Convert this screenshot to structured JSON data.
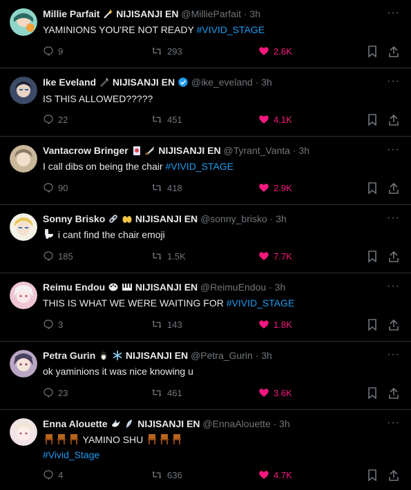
{
  "tweets": [
    {
      "name": "Millie Parfait",
      "name_emojis": [
        "wand"
      ],
      "agency": "NIJISANJI EN",
      "handle": "@MillieParfait",
      "time": "3h",
      "verified": false,
      "text": "YAMINIONS YOU'RE NOT READY",
      "hashtag": "#VIVID_STAGE",
      "text_emojis": [],
      "replies": "9",
      "retweets": "293",
      "likes": "2.6K",
      "avatar_color": "#8fd6c8"
    },
    {
      "name": "Ike Eveland",
      "name_emojis": [
        "pen"
      ],
      "agency": "NIJISANJI EN",
      "handle": "@ike_eveland",
      "time": "3h",
      "verified": true,
      "text": "IS THIS ALLOWED?????",
      "hashtag": "",
      "text_emojis": [],
      "replies": "22",
      "retweets": "451",
      "likes": "4.1K",
      "avatar_color": "#3b4a66"
    },
    {
      "name": "Vantacrow Bringer",
      "name_emojis": [
        "card",
        "knife"
      ],
      "agency": "NIJISANJI EN",
      "handle": "@Tyrant_Vanta",
      "time": "3h",
      "verified": false,
      "text": "I call dibs on being the chair",
      "hashtag": "#VIVID_STAGE",
      "text_emojis": [],
      "replies": "90",
      "retweets": "418",
      "likes": "2.9K",
      "avatar_color": "#c9b79a"
    },
    {
      "name": "Sonny Brisko",
      "name_emojis": [
        "link",
        "hands"
      ],
      "agency": "NIJISANJI EN",
      "handle": "@sonny_brisko",
      "time": "3h",
      "verified": false,
      "text": "i cant find the chair emoji",
      "hashtag": "",
      "text_emojis": [
        "toilet"
      ],
      "replies": "185",
      "retweets": "1.5K",
      "likes": "7.7K",
      "avatar_color": "#e8d27a"
    },
    {
      "name": "Reimu Endou",
      "name_emojis": [
        "palette",
        "piano"
      ],
      "agency": "NIJISANJI EN",
      "handle": "@ReimuEndou",
      "time": "3h",
      "verified": false,
      "text": "THIS IS WHAT WE WERE WAITING FOR ",
      "hashtag": "#VIVID_STAGE",
      "text_emojis": [],
      "replies": "3",
      "retweets": "143",
      "likes": "1.8K",
      "avatar_color": "#f0c6d4"
    },
    {
      "name": "Petra Gurin",
      "name_emojis": [
        "penguin",
        "snowflake"
      ],
      "agency": "NIJISANJI EN",
      "handle": "@Petra_Gurin",
      "time": "3h",
      "verified": false,
      "text": "ok yaminions it was nice knowing u",
      "hashtag": "",
      "text_emojis": [],
      "replies": "23",
      "retweets": "461",
      "likes": "3.6K",
      "avatar_color": "#b9a6c4"
    },
    {
      "name": "Enna Alouette",
      "name_emojis": [
        "dove",
        "feather"
      ],
      "agency": "NIJISANJI EN",
      "handle": "@EnnaAlouette",
      "time": "3h",
      "verified": false,
      "text": "YAMINO SHU",
      "hashtag": "#Vivid_Stage",
      "text_emojis": [
        "chair",
        "chair",
        "chair"
      ],
      "text_emojis_after": [
        "chair",
        "chair",
        "chair"
      ],
      "replies": "4",
      "retweets": "636",
      "likes": "4.7K",
      "avatar_color": "#f2e3e6"
    }
  ],
  "colors": {
    "background": "#000000",
    "text": "#e7e9ea",
    "muted": "#71767b",
    "link": "#1d9bf0",
    "like": "#f91880",
    "border": "#2f3336"
  }
}
